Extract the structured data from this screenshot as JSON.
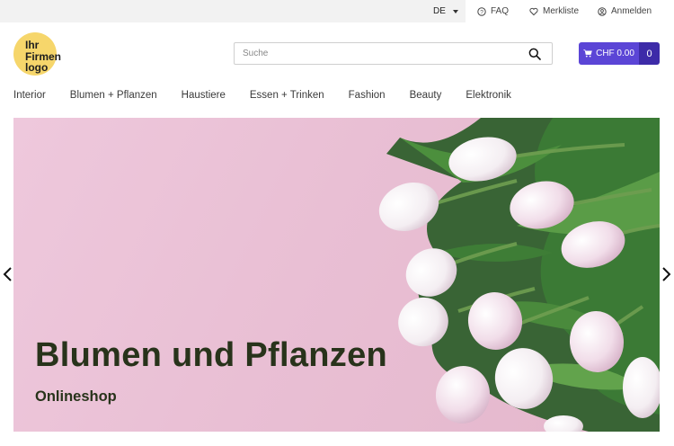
{
  "topbar": {
    "language": "DE",
    "faq_label": "FAQ",
    "wishlist_label": "Merkliste",
    "login_label": "Anmelden"
  },
  "logo": {
    "line1": "Ihr",
    "line2": "Firmen",
    "line3": "logo",
    "color": "#f6d66b"
  },
  "search": {
    "placeholder": "Suche"
  },
  "cart": {
    "amount": "CHF 0.00",
    "count": "0",
    "color": "#5b45d6"
  },
  "nav": {
    "items": [
      "Interior",
      "Blumen + Pflanzen",
      "Haustiere",
      "Essen + Trinken",
      "Fashion",
      "Beauty",
      "Elektronik"
    ]
  },
  "hero": {
    "title": "Blumen und Pflanzen",
    "subtitle": "Onlineshop",
    "background": "#e9bfd4"
  },
  "icons": [
    "chevron-down-icon",
    "question-circle-icon",
    "heart-icon",
    "user-circle-icon",
    "search-icon",
    "cart-icon",
    "chevron-left-icon",
    "chevron-right-icon"
  ]
}
